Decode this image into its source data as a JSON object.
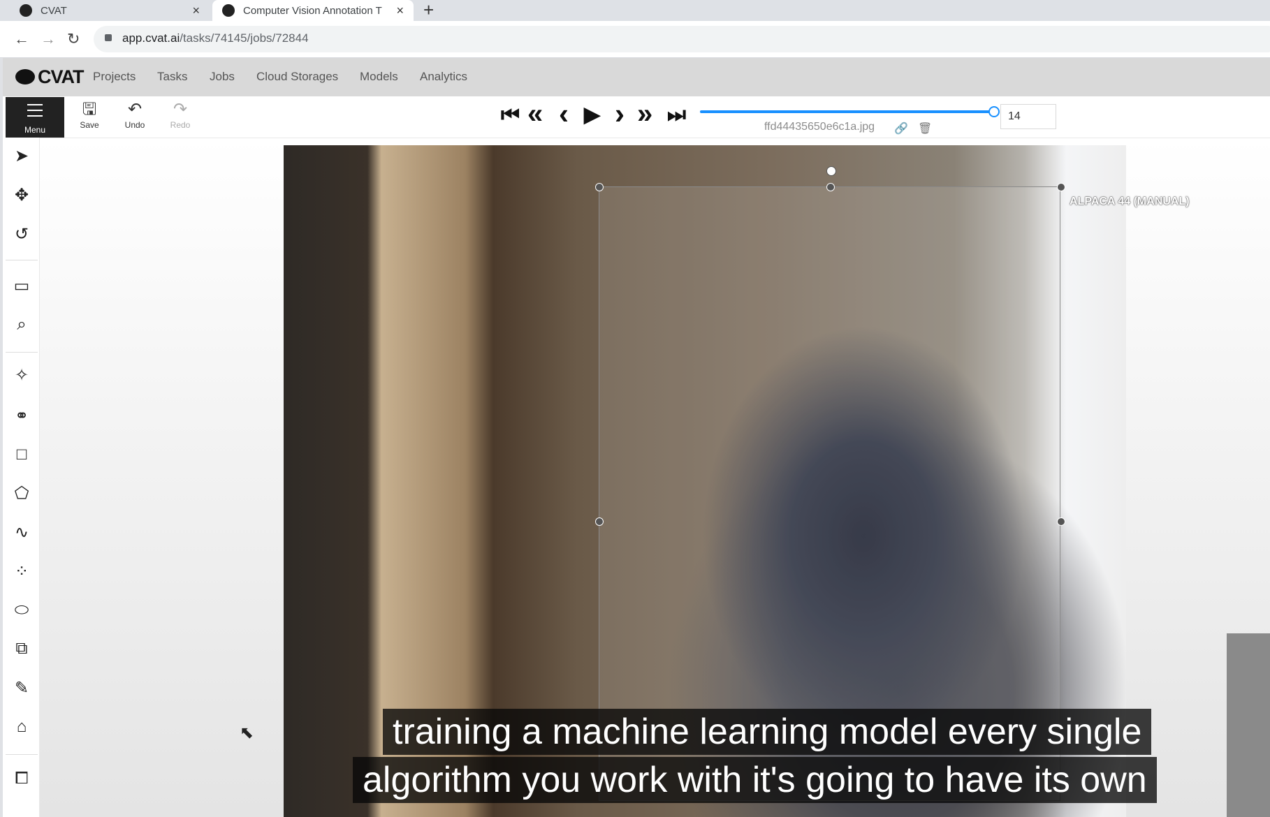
{
  "browser": {
    "tabs": [
      {
        "title": "CVAT",
        "close": "×"
      },
      {
        "title": "Computer Vision Annotation T",
        "close": "×"
      }
    ],
    "new_tab": "+",
    "nav": {
      "back": "←",
      "forward": "→",
      "reload": "↻"
    },
    "url_domain": "app.cvat.ai",
    "url_path": "/tasks/74145/jobs/72844"
  },
  "app": {
    "logo": "CVAT",
    "nav": [
      "Projects",
      "Tasks",
      "Jobs",
      "Cloud Storages",
      "Models",
      "Analytics"
    ]
  },
  "toolbar": {
    "menu_label": "Menu",
    "save_label": "Save",
    "undo_label": "Undo",
    "redo_label": "Redo",
    "player": {
      "first": "⏮",
      "back_fast": "«",
      "back": "‹",
      "play": "▶",
      "next": "›",
      "forward_fast": "»",
      "last": "⏭"
    },
    "frame_value": "14",
    "filename": "ffd44435650e6c1a.jpg",
    "slider_fraction": 0.98
  },
  "sidebar": {
    "icons": [
      "cursor-icon",
      "move-icon",
      "rotate-icon",
      "fit-image-icon",
      "zoom-region-icon",
      "magic-wand-icon",
      "opencv-icon",
      "rectangle-icon",
      "polygon-icon",
      "polyline-icon",
      "points-icon",
      "ellipse-icon",
      "cuboid-icon",
      "brush-icon",
      "tag-icon",
      "group-icon"
    ]
  },
  "canvas": {
    "object_label": "ALPACA 44 (MANUAL)"
  },
  "caption": {
    "line1": "training a machine learning model every single",
    "line2": "algorithm you work with it's going to have its own"
  },
  "colors": {
    "accent": "#1890ff",
    "menu_bg": "#222222"
  }
}
